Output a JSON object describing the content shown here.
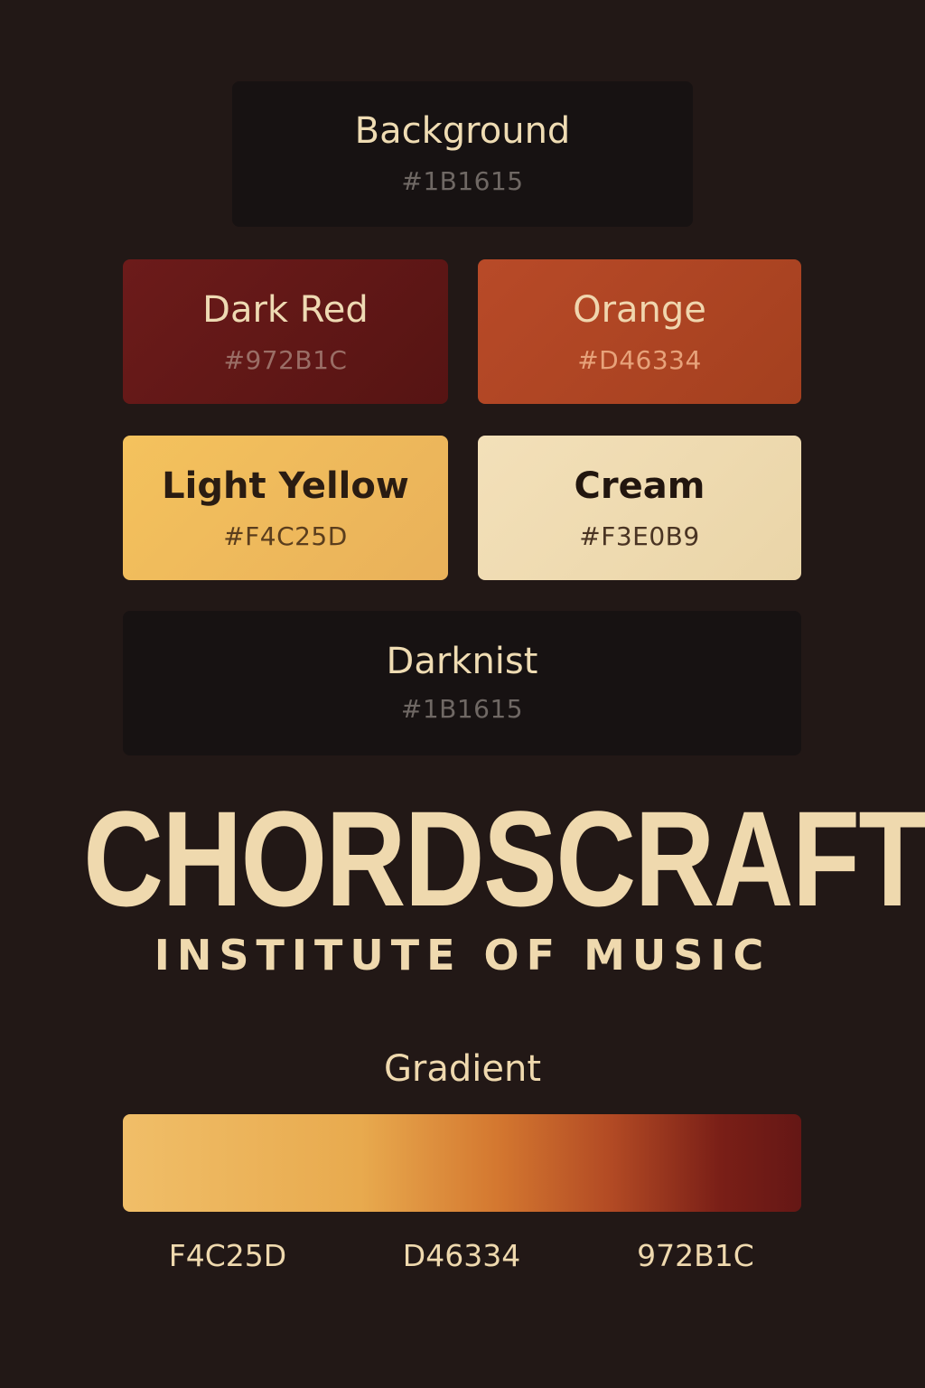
{
  "swatches": {
    "background": {
      "name": "Background",
      "hex": "#1B1615",
      "color": "#1B1615"
    },
    "dark_red": {
      "name": "Dark Red",
      "hex": "#972B1C",
      "color": "#972B1C"
    },
    "orange": {
      "name": "Orange",
      "hex": "#D46334",
      "color": "#D46334"
    },
    "light_yellow": {
      "name": "Light Yellow",
      "hex": "#F4C25D",
      "color": "#F4C25D"
    },
    "cream": {
      "name": "Cream",
      "hex": "#F3E0B9",
      "color": "#F3E0B9"
    },
    "darknist": {
      "name": "Darknist",
      "hex": "#1B1615",
      "color": "#1B1615"
    }
  },
  "brand": {
    "name": "CHORDSCRAFT",
    "subtitle": "INSTITUTE OF MUSIC"
  },
  "gradient": {
    "title": "Gradient",
    "stops": [
      "F4C25D",
      "D46334",
      "972B1C"
    ]
  }
}
